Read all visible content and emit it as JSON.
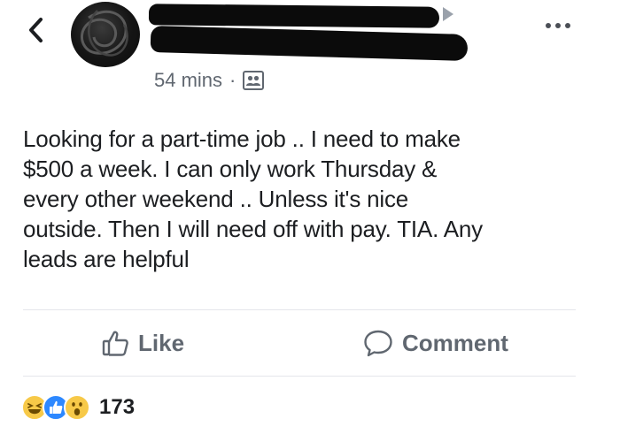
{
  "post": {
    "timestamp": "54 mins",
    "separator": "·",
    "audience_icon": "friends-audience-icon",
    "text": "Looking for a part-time job .. I need to make\n$500 a week. I can only work Thursday &\nevery other weekend .. Unless it's nice\noutside. Then I will need off with pay. TIA. Any\nleads are helpful"
  },
  "actions": {
    "like_label": "Like",
    "comment_label": "Comment"
  },
  "reactions": {
    "types": [
      "haha",
      "like",
      "wow"
    ],
    "count": "173"
  },
  "colors": {
    "accent_like": "#2d88ff",
    "reaction_yellow": "#f7c948",
    "secondary_text": "#606770"
  }
}
